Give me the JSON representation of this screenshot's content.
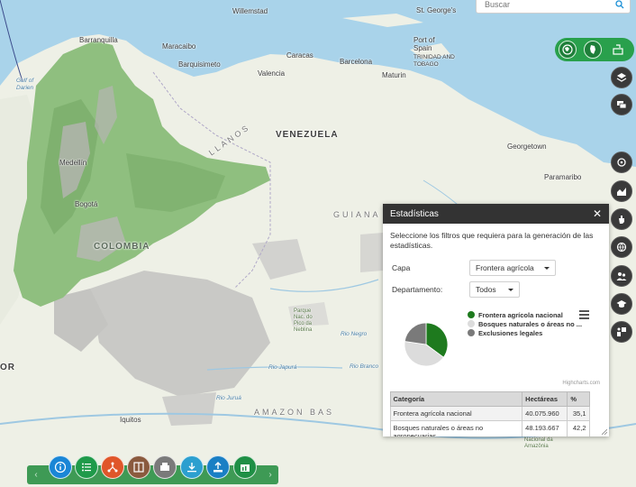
{
  "search": {
    "placeholder": "Buscar"
  },
  "map_labels": {
    "willemstad": "Willemstad",
    "st_georges": "St. George's",
    "port_of_spain": "Port of\nSpain",
    "trinidad": "TRINIDAD AND\nTOBAGO",
    "barranquilla": "Barranquilla",
    "maracaibo": "Maracaibo",
    "caracas": "Caracas",
    "barquisimeto": "Barquisimeto",
    "valencia": "Valencia",
    "barcelona": "Barcelona",
    "maturin": "Maturin",
    "gulf": "Gulf of\nDarien",
    "llanos": "LLANOS",
    "venezuela": "VENEZUELA",
    "georgetown": "Georgetown",
    "paramaribo": "Paramaribo",
    "guiana": "GUIANA",
    "medellin": "Medellín",
    "bogota": "Bogotá",
    "colombia": "COLOMBIA",
    "amazon": "AMAZON BAS",
    "iquitos": "Iquitos",
    "parque": "Parque\nNac. do\nPico da\nNeblina",
    "rio_negro": "Rio Negro",
    "rio_japura": "Rio Japurá",
    "rio_branco": "Rio Branco",
    "rio_jurua": "Rio Juruá",
    "pacific_r": "OR",
    "amazonia": "Parque\nNacional da\nAmazônia"
  },
  "panel": {
    "title": "Estadísticas",
    "intro": "Seleccione los filtros que requiera para la generación de las estadísticas.",
    "capa_label": "Capa",
    "capa_value": "Frontera agrícola",
    "depto_label": "Departamento:",
    "depto_value": "Todos",
    "credits": "Highcharts.com"
  },
  "chart_data": {
    "type": "pie",
    "categories": [
      "Frontera agrícola nacional",
      "Bosques naturales o áreas no ...",
      "Exclusiones legales"
    ],
    "values": [
      35.1,
      42.2,
      22.7
    ],
    "colors": [
      "#1e7a1e",
      "#dcdcdc",
      "#7a7a7a"
    ]
  },
  "table": {
    "headers": [
      "Categoría",
      "Hectáreas",
      "%"
    ],
    "rows": [
      [
        "Frontera agrícola nacional",
        "40.075.960",
        "35,1"
      ],
      [
        "Bosques naturales o áreas no agropecuarias",
        "48.193.667",
        "42,2"
      ]
    ]
  },
  "colors": {
    "accent_green": "#29a04c",
    "panel_header": "#333333"
  },
  "toolbar_icons": [
    "info-icon",
    "list-icon",
    "share-icon",
    "compare-icon",
    "print-icon",
    "download-icon",
    "upload-icon",
    "stats-icon"
  ]
}
